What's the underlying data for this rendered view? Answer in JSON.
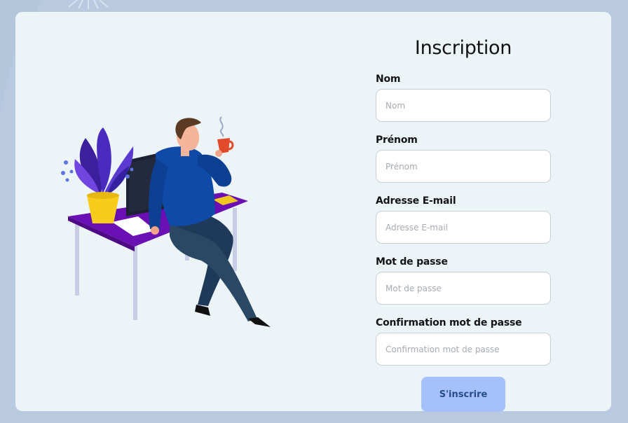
{
  "form": {
    "title": "Inscription",
    "fields": [
      {
        "label": "Nom",
        "placeholder": "Nom"
      },
      {
        "label": "Prénom",
        "placeholder": "Prénom"
      },
      {
        "label": "Adresse E-mail",
        "placeholder": "Adresse E-mail"
      },
      {
        "label": "Mot de passe",
        "placeholder": "Mot de passe"
      },
      {
        "label": "Confirmation mot de passe",
        "placeholder": "Confirmation mot de passe"
      }
    ],
    "submit_label": "S'inscrire"
  },
  "colors": {
    "page_background": "#b9cae0",
    "card_background": "#ecf4f8",
    "button_background": "#a6c0fb",
    "button_text": "#244c8a"
  },
  "illustration": {
    "icon": "man-drinking-coffee-at-desk-illustration"
  }
}
